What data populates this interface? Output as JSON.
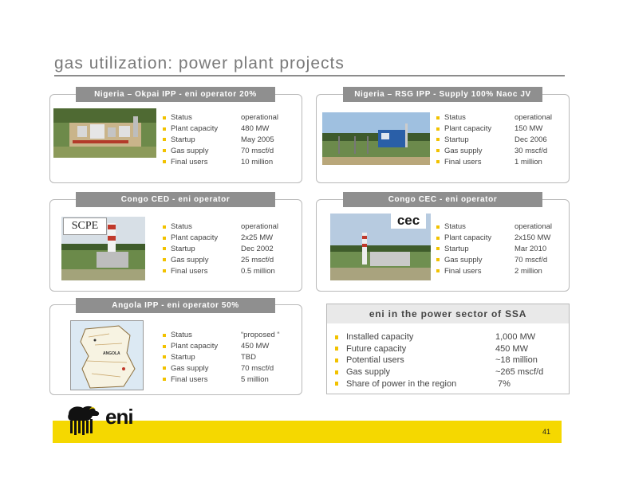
{
  "slide": {
    "title": "gas utilization: power plant projects",
    "page_number": "41"
  },
  "spec_labels": {
    "status": "Status",
    "plant_capacity": "Plant capacity",
    "startup": "Startup",
    "gas_supply": "Gas supply",
    "final_users": "Final users"
  },
  "projects": [
    {
      "header": "Nigeria – Okpai IPP - eni operator 20%",
      "status": "operational",
      "plant_capacity": "480 MW",
      "startup": "May 2005",
      "gas_supply": "70 mscf/d",
      "final_users": "10 million"
    },
    {
      "header": "Nigeria – RSG IPP - Supply 100% Naoc JV",
      "status": "operational",
      "plant_capacity": "150 MW",
      "startup": "Dec 2006",
      "gas_supply": "30 mscf/d",
      "final_users": "1 million"
    },
    {
      "header": "Congo CED - eni operator",
      "logo_text": "SCPE",
      "status": "operational",
      "plant_capacity": "2x25 MW",
      "startup": "Dec 2002",
      "gas_supply": "25 mscf/d",
      "final_users": "0.5 million"
    },
    {
      "header": "Congo CEC - eni operator",
      "logo_text": "cec",
      "status": "operational",
      "plant_capacity": "2x150 MW",
      "startup": "Mar 2010",
      "gas_supply": "70 mscf/d",
      "final_users": "2 million"
    },
    {
      "header": "Angola IPP - eni operator 50%",
      "map_label_country": "ANGOLA",
      "status": "“proposed “",
      "plant_capacity": "450 MW",
      "startup": "TBD",
      "gas_supply": "70 mscf/d",
      "final_users": "5 million"
    }
  ],
  "summary": {
    "title": "eni in the power sector of SSA",
    "items": [
      {
        "label": "Installed capacity",
        "value": "1,000 MW"
      },
      {
        "label": "Future capacity",
        "value": "450 MW"
      },
      {
        "label": "Potential users",
        "value": "~18 million"
      },
      {
        "label": "Gas supply",
        "value": "~265 mscf/d"
      },
      {
        "label": "Share of power in the region",
        "value": " 7%"
      }
    ]
  },
  "brand": {
    "logo_text": "eni",
    "accent_yellow": "#f5d800",
    "bullet_yellow": "#f2c200",
    "header_gray": "#8f8f8f",
    "icon": "six-legged-dog-icon"
  }
}
